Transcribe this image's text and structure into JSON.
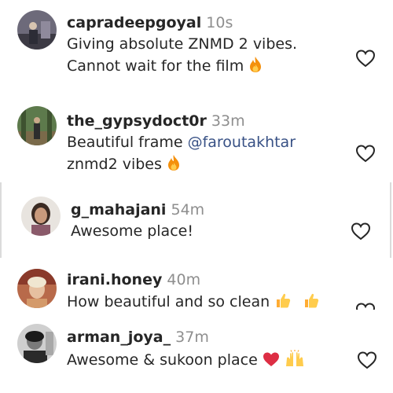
{
  "comments": [
    {
      "username": "capradeepgoyal",
      "time": "10s",
      "line1": "Giving absolute ZNMD 2 vibes.",
      "line2": "Cannot wait for the film",
      "emoji": "fire-icon"
    },
    {
      "username": "the_gypsydoct0r",
      "time": "33m",
      "line1_prefix": "Beautiful frame ",
      "mention": "@faroutakhtar",
      "line2": "znmd2 vibes",
      "emoji": "fire-icon"
    },
    {
      "username": "g_mahajani",
      "time": "54m",
      "line1": "Awesome place!"
    },
    {
      "username": "irani.honey",
      "time": "40m",
      "line1": "How beautiful and so clean",
      "emoji": "thumbs-up-icon"
    },
    {
      "username": "arman_joya_",
      "time": "37m",
      "line1": "Awesome & sukoon place",
      "emoji": "red-heart-icon raised-hands-icon"
    }
  ],
  "colors": {
    "username": "#262626",
    "time": "#8e8e8e",
    "mention": "#385185",
    "heart_outline": "#262626",
    "fire": "#f4900c",
    "thumbs": "#ffcc4d",
    "red_heart": "#dd2e44"
  }
}
